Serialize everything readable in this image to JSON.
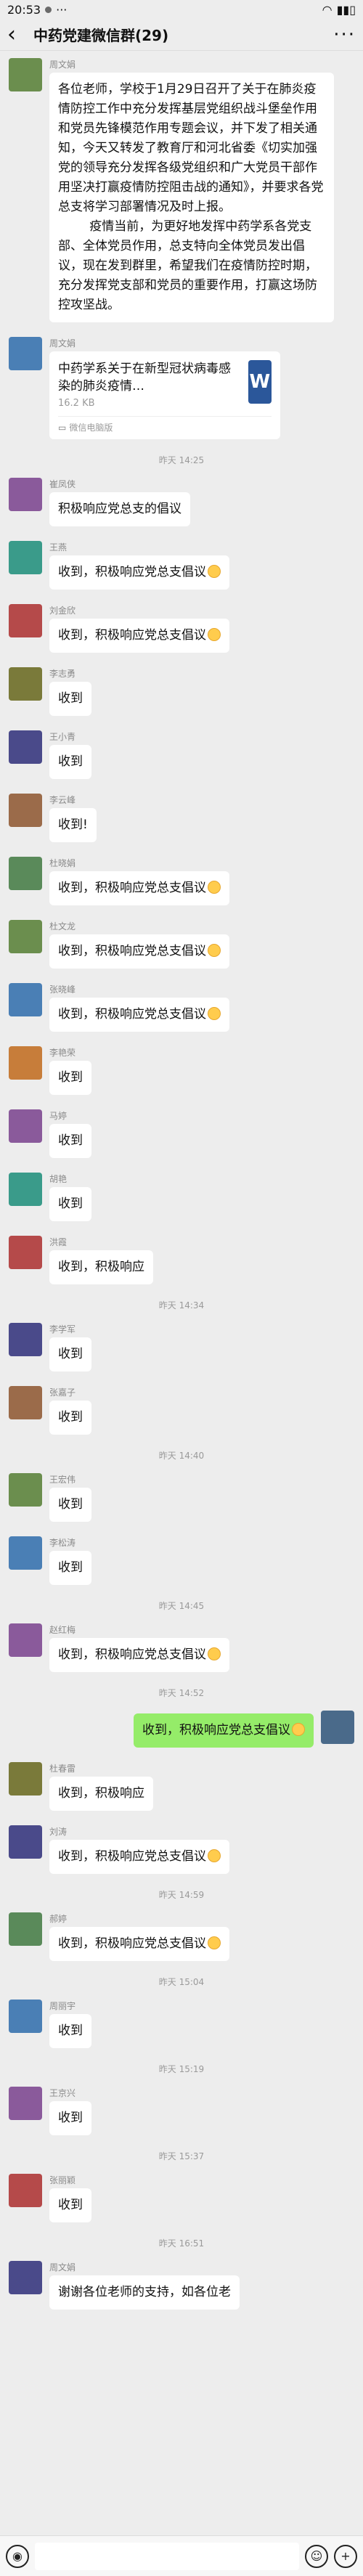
{
  "status": {
    "time": "20:53",
    "dots": "···",
    "battery": "▮▮▯"
  },
  "header": {
    "title": "中药党建微信群(29)",
    "more": "···"
  },
  "messages": [
    {
      "sender": "周文娟",
      "text": "各位老师，学校于1月29日召开了关于在肺炎疫情防控工作中充分发挥基层党组织战斗堡垒作用和党员先锋模范作用专题会议，并下发了相关通知，今天又转发了教育厅和河北省委《切实加强党的领导充分发挥各级党组织和广大党员干部作用坚决打赢疫情防控阻击战的通知》，并要求各党总支将学习部署情况及时上报。\n        疫情当前，为更好地发挥中药学系各党支部、全体党员作用，总支特向全体党员发出倡议，现在发到群里，希望我们在疫情防控时期，充分发挥党支部和党员的重要作用，打赢这场防控攻坚战。"
    },
    {
      "sender": "周文娟",
      "file_title": "中药学系关于在新型冠状病毒感染的肺炎疫情…",
      "file_size": "16.2 KB",
      "file_source": "微信电脑版"
    },
    {
      "time": "昨天 14:25"
    },
    {
      "sender": "崔凤侠",
      "text": "积极响应党总支的倡议"
    },
    {
      "sender": "王燕",
      "text": "收到，积极响应党总支倡议"
    },
    {
      "sender": "刘金欣",
      "text": "收到，积极响应党总支倡议"
    },
    {
      "sender": "李志勇",
      "text": "收到"
    },
    {
      "sender": "王小青",
      "text": "收到"
    },
    {
      "sender": "李云峰",
      "text": "收到!"
    },
    {
      "sender": "杜晓娟",
      "text": "收到，积极响应党总支倡议"
    },
    {
      "sender": "杜文龙",
      "text": "收到，积极响应党总支倡议"
    },
    {
      "sender": "张晓峰",
      "text": "收到，积极响应党总支倡议"
    },
    {
      "sender": "李艳荣",
      "text": "收到"
    },
    {
      "sender": "马婷",
      "text": "收到"
    },
    {
      "sender": "胡艳",
      "text": "收到"
    },
    {
      "sender": "洪霞",
      "text": "收到，积极响应"
    },
    {
      "time": "昨天 14:34"
    },
    {
      "sender": "李学军",
      "text": "收到"
    },
    {
      "sender": "张嘉子",
      "text": "收到"
    },
    {
      "time": "昨天 14:40"
    },
    {
      "sender": "王宏伟",
      "text": "收到"
    },
    {
      "sender": "李松涛",
      "text": "收到"
    },
    {
      "time": "昨天 14:45"
    },
    {
      "sender": "赵红梅",
      "text": "收到，积极响应党总支倡议"
    },
    {
      "time": "昨天 14:52"
    },
    {
      "self": true,
      "text": "收到，积极响应党总支倡议"
    },
    {
      "sender": "杜春雷",
      "text": "收到，积极响应"
    },
    {
      "sender": "刘涛",
      "text": "收到，积极响应党总支倡议"
    },
    {
      "time": "昨天 14:59"
    },
    {
      "sender": "郝婷",
      "text": "收到，积极响应党总支倡议"
    },
    {
      "time": "昨天 15:04"
    },
    {
      "sender": "周丽宇",
      "text": "收到"
    },
    {
      "time": "昨天 15:19"
    },
    {
      "sender": "王京兴",
      "text": "收到"
    },
    {
      "time": "昨天 15:37"
    },
    {
      "sender": "张丽颖",
      "text": "收到"
    },
    {
      "time": "昨天 16:51"
    },
    {
      "sender": "周文娟",
      "text": "谢谢各位老师的支持，如各位老"
    }
  ],
  "colors": {
    "bg": "#ededed",
    "bubble": "#ffffff",
    "self_bubble": "#95ec69",
    "word": "#2b579a"
  }
}
